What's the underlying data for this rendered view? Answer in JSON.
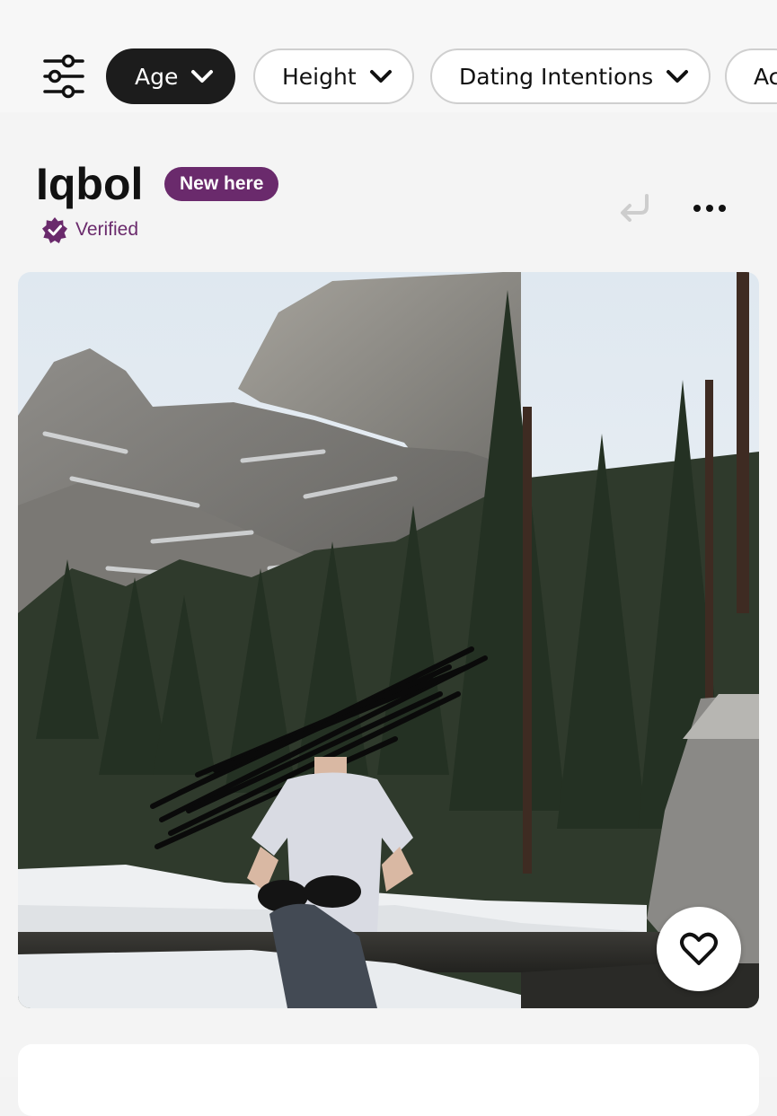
{
  "filters": {
    "chips": [
      {
        "label": "Age",
        "active": true
      },
      {
        "label": "Height",
        "active": false
      },
      {
        "label": "Dating Intentions",
        "active": false
      },
      {
        "label": "Ac",
        "active": false
      }
    ]
  },
  "profile": {
    "name": "Iqbol",
    "new_badge": "New here",
    "verified_label": "Verified",
    "accent_color": "#6a2a6c"
  },
  "icons": [
    "sliders-icon",
    "chevron-down-icon",
    "verified-badge-icon",
    "undo-icon",
    "more-options-icon",
    "heart-icon"
  ]
}
